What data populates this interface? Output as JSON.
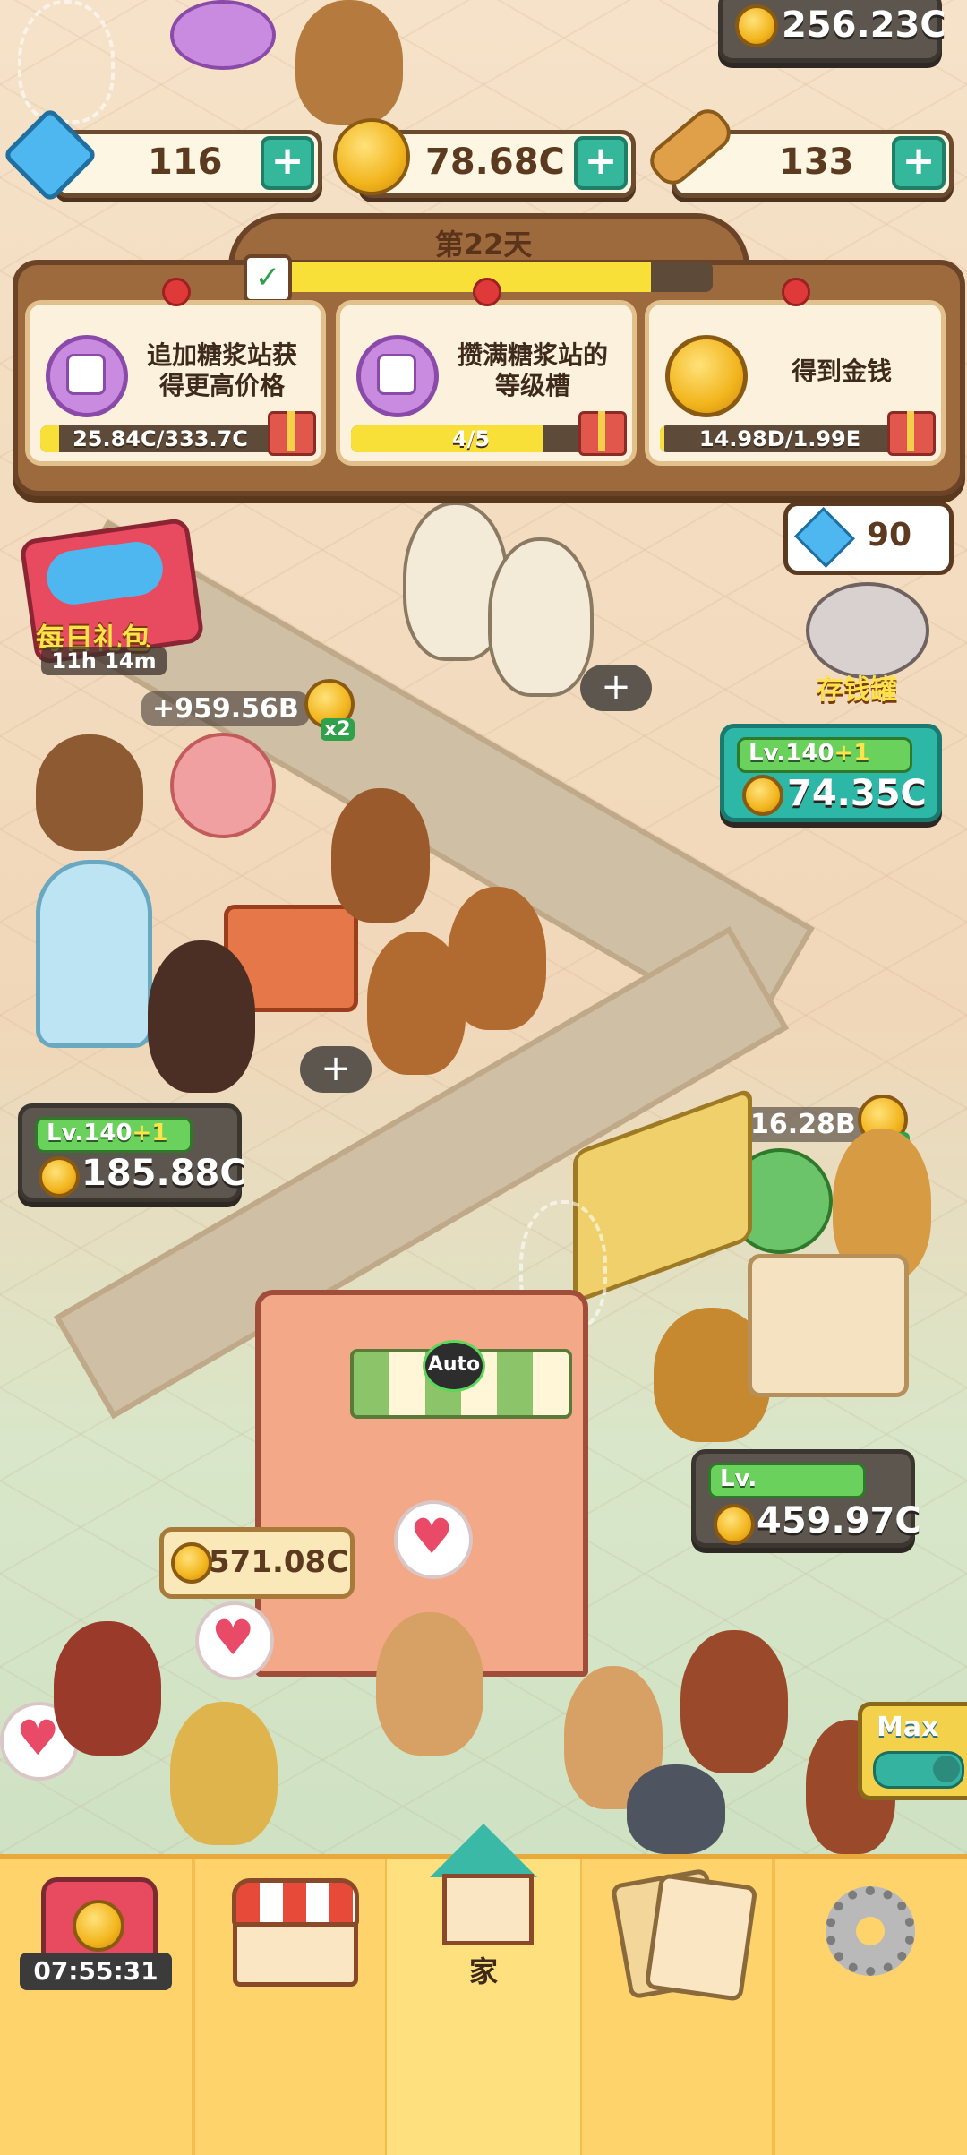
{
  "hud": {
    "gems": "116",
    "coins": "78.68C",
    "bones": "133",
    "top_right_money": "256.23C"
  },
  "day_panel": {
    "title": "第22天",
    "progress": 0.86,
    "tasks": [
      {
        "text_line1": "追加糖浆站获",
        "text_line2": "得更高价格",
        "progress_label": "25.84C/333.7C",
        "progress": 0.08,
        "icon": "syrup-jar-icon"
      },
      {
        "text_line1": "攒满糖浆站的",
        "text_line2": "等级槽",
        "progress_label": "4/5",
        "progress": 0.8,
        "icon": "syrup-jar-icon"
      },
      {
        "text_line1": "得到金钱",
        "text_line2": "",
        "progress_label": "14.98D/1.99E",
        "progress": 0.02,
        "icon": "coin-icon"
      }
    ]
  },
  "scene": {
    "daily_gift_label": "每日礼包",
    "daily_gift_timer": "11h 14m",
    "piggy_bank_gems": "90",
    "piggy_bank_label": "存钱罐",
    "float_earn_1": "+959.56B",
    "float_earn_2": "+716.28B",
    "multiplier": "x2",
    "auto_label": "Auto",
    "max_label": "Max",
    "stations": [
      {
        "level": "Lv.140",
        "bonus": "+1",
        "money": "74.35C"
      },
      {
        "level": "Lv.140",
        "bonus": "+1",
        "money": "185.88C"
      },
      {
        "level": "Lv.",
        "bonus": "",
        "money": "459.97C"
      }
    ],
    "cashier_money": "571.08C"
  },
  "bottom_nav": {
    "timer": "07:55:31",
    "home_label": "家"
  },
  "colors": {
    "accent_teal": "#34b79a",
    "nav_yellow": "#ffd36c",
    "panel_brown": "#9d6a3e"
  }
}
